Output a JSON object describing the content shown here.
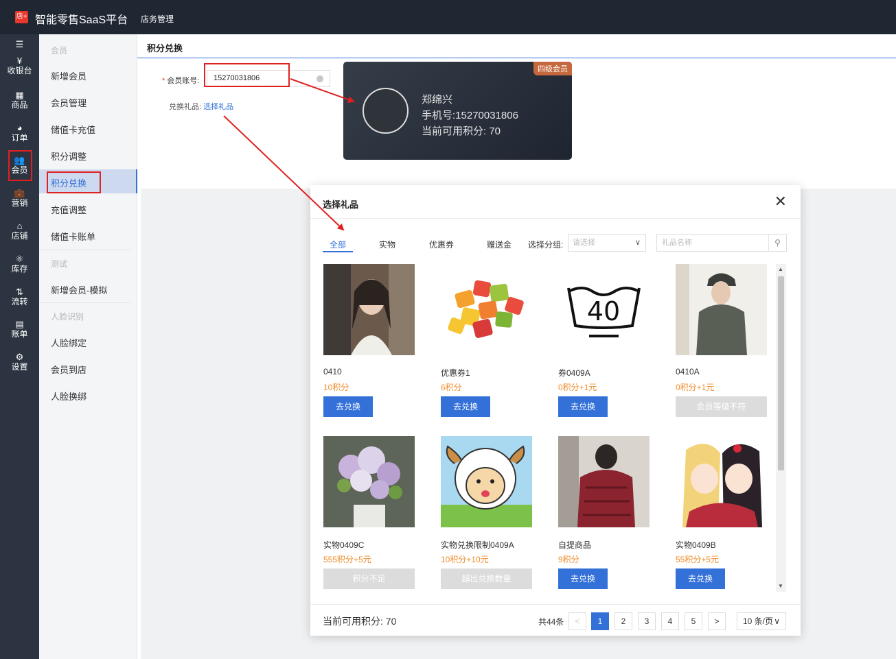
{
  "topbar": {
    "logo": "店+",
    "app_title": "智能零售SaaS平台",
    "nav": "店务管理"
  },
  "iconbar": [
    {
      "icon": "☰",
      "label": ""
    },
    {
      "icon": "¥",
      "label": "收银台"
    },
    {
      "icon": "▦",
      "label": "商品"
    },
    {
      "icon": "◕",
      "label": "订单"
    },
    {
      "icon": "👥",
      "label": "会员"
    },
    {
      "icon": "💼",
      "label": "营销"
    },
    {
      "icon": "⌂",
      "label": "店铺"
    },
    {
      "icon": "⚛",
      "label": "库存"
    },
    {
      "icon": "⇅",
      "label": "流转"
    },
    {
      "icon": "▤",
      "label": "账单"
    },
    {
      "icon": "⚙",
      "label": "设置"
    }
  ],
  "submenu": {
    "group1": "会员",
    "items1": [
      "新增会员",
      "会员管理",
      "储值卡充值",
      "积分调整",
      "积分兑换",
      "充值调整",
      "储值卡账单"
    ],
    "group2": "测试",
    "items2": [
      "新增会员-模拟"
    ],
    "group3": "人脸识别",
    "items3": [
      "人脸绑定",
      "会员到店",
      "人脸换绑"
    ]
  },
  "page": {
    "title": "积分兑换",
    "account_label": "会员账号:",
    "account_value": "15270031806",
    "gift_label": "兑换礼品:",
    "gift_link": "选择礼品"
  },
  "member_card": {
    "level": "四级会员",
    "name": "郑绵兴",
    "phone": "手机号:15270031806",
    "points": "当前可用积分: 70"
  },
  "dialog": {
    "title": "选择礼品",
    "close": "✕",
    "tabs": [
      "全部",
      "实物",
      "优惠券",
      "赠送金"
    ],
    "group_label": "选择分组:",
    "group_placeholder": "请选择",
    "name_placeholder": "礼品名称",
    "products": [
      {
        "name": "0410",
        "price": "10积分",
        "button": "去兑换",
        "enabled": true
      },
      {
        "name": "优惠券1",
        "price": "6积分",
        "button": "去兑换",
        "enabled": true
      },
      {
        "name": "券0409A",
        "price": "0积分+1元",
        "button": "去兑换",
        "enabled": true
      },
      {
        "name": "0410A",
        "price": "0积分+1元",
        "button": "会员等级不符",
        "enabled": false
      },
      {
        "name": "实物0409C",
        "price": "555积分+5元",
        "button": "积分不足",
        "enabled": false
      },
      {
        "name": "实物兑换限制0409A",
        "price": "10积分+10元",
        "button": "超出兑换数量",
        "enabled": false
      },
      {
        "name": "自提商品",
        "price": "9积分",
        "button": "去兑换",
        "enabled": true
      },
      {
        "name": "实物0409B",
        "price": "55积分+5元",
        "button": "去兑换",
        "enabled": true
      }
    ],
    "footer_points": "当前可用积分: 70",
    "total": "共44条",
    "pages": [
      "1",
      "2",
      "3",
      "4",
      "5"
    ],
    "current_page": "1",
    "prev": "<",
    "next": ">",
    "page_size": "10 条/页"
  },
  "colors": {
    "accent": "#3370d8",
    "price": "#f08c2a",
    "highlight": "#e02020",
    "topbar": "#1f2733"
  }
}
